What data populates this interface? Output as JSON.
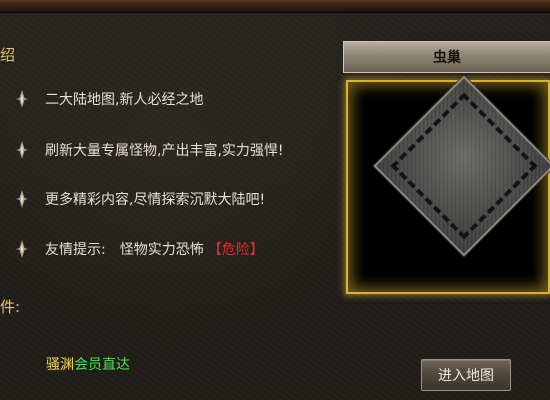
{
  "intro": {
    "title": "绍",
    "bullets": [
      {
        "text": "二大陆地图,新人必经之地"
      },
      {
        "text": "刷新大量专属怪物,产出丰富,实力强悍!"
      },
      {
        "text": "更多精彩内容,尽情探索沉默大陆吧!"
      }
    ],
    "hint": {
      "label": "友情提示:",
      "value": "怪物实力恐怖",
      "danger": "【危险】"
    }
  },
  "conditions": {
    "label": "件:",
    "vip_link": {
      "part1": "骚渊",
      "part2": "会员直达"
    }
  },
  "map_panel": {
    "title": "虫巢",
    "enter_button": "进入地图"
  },
  "colors": {
    "gold_text": "#e6c86a",
    "danger_red": "#e0302a",
    "vip_yellow": "#f4d84c",
    "vip_green": "#4ce04c",
    "frame_gold": "#d9b233"
  }
}
